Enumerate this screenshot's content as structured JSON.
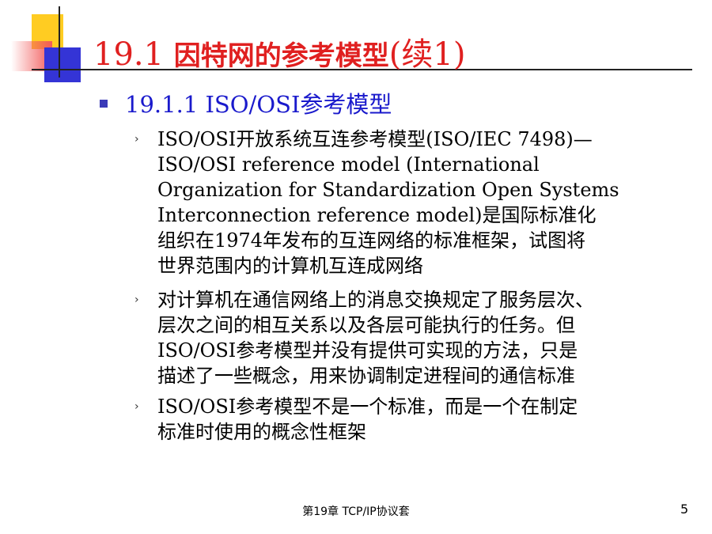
{
  "slide": {
    "title_num": "19.1",
    "title_cn": "因特网的参考模型",
    "title_suffix": "(续1)",
    "heading": "19.1.1 ISO/OSI参考模型",
    "bullets": [
      {
        "lines": [
          "ISO/OSI开放系统互连参考模型(ISO/IEC 7498)—",
          "ISO/OSI reference model (International",
          "Organization for Standardization Open Systems",
          "Interconnection reference model)是国际标准化",
          "组织在1974年发布的互连网络的标准框架，试图将",
          "世界范围内的计算机互连成网络"
        ]
      },
      {
        "lines": [
          "对计算机在通信网络上的消息交换规定了服务层次、",
          "层次之间的相互关系以及各层可能执行的任务。但",
          "ISO/OSI参考模型并没有提供可实现的方法，只是",
          "描述了一些概念，用来协调制定进程间的通信标准"
        ]
      },
      {
        "lines": [
          "ISO/OSI参考模型不是一个标准，而是一个在制定",
          "标准时使用的概念性框架"
        ]
      }
    ],
    "footer": "第19章 TCP/IP协议套",
    "page_number": "5"
  },
  "colors": {
    "title": "#e02020",
    "heading": "#1a1acc",
    "accent_yellow": "#ffcc22",
    "accent_blue": "#3434d6",
    "accent_red": "#f25a5a"
  }
}
